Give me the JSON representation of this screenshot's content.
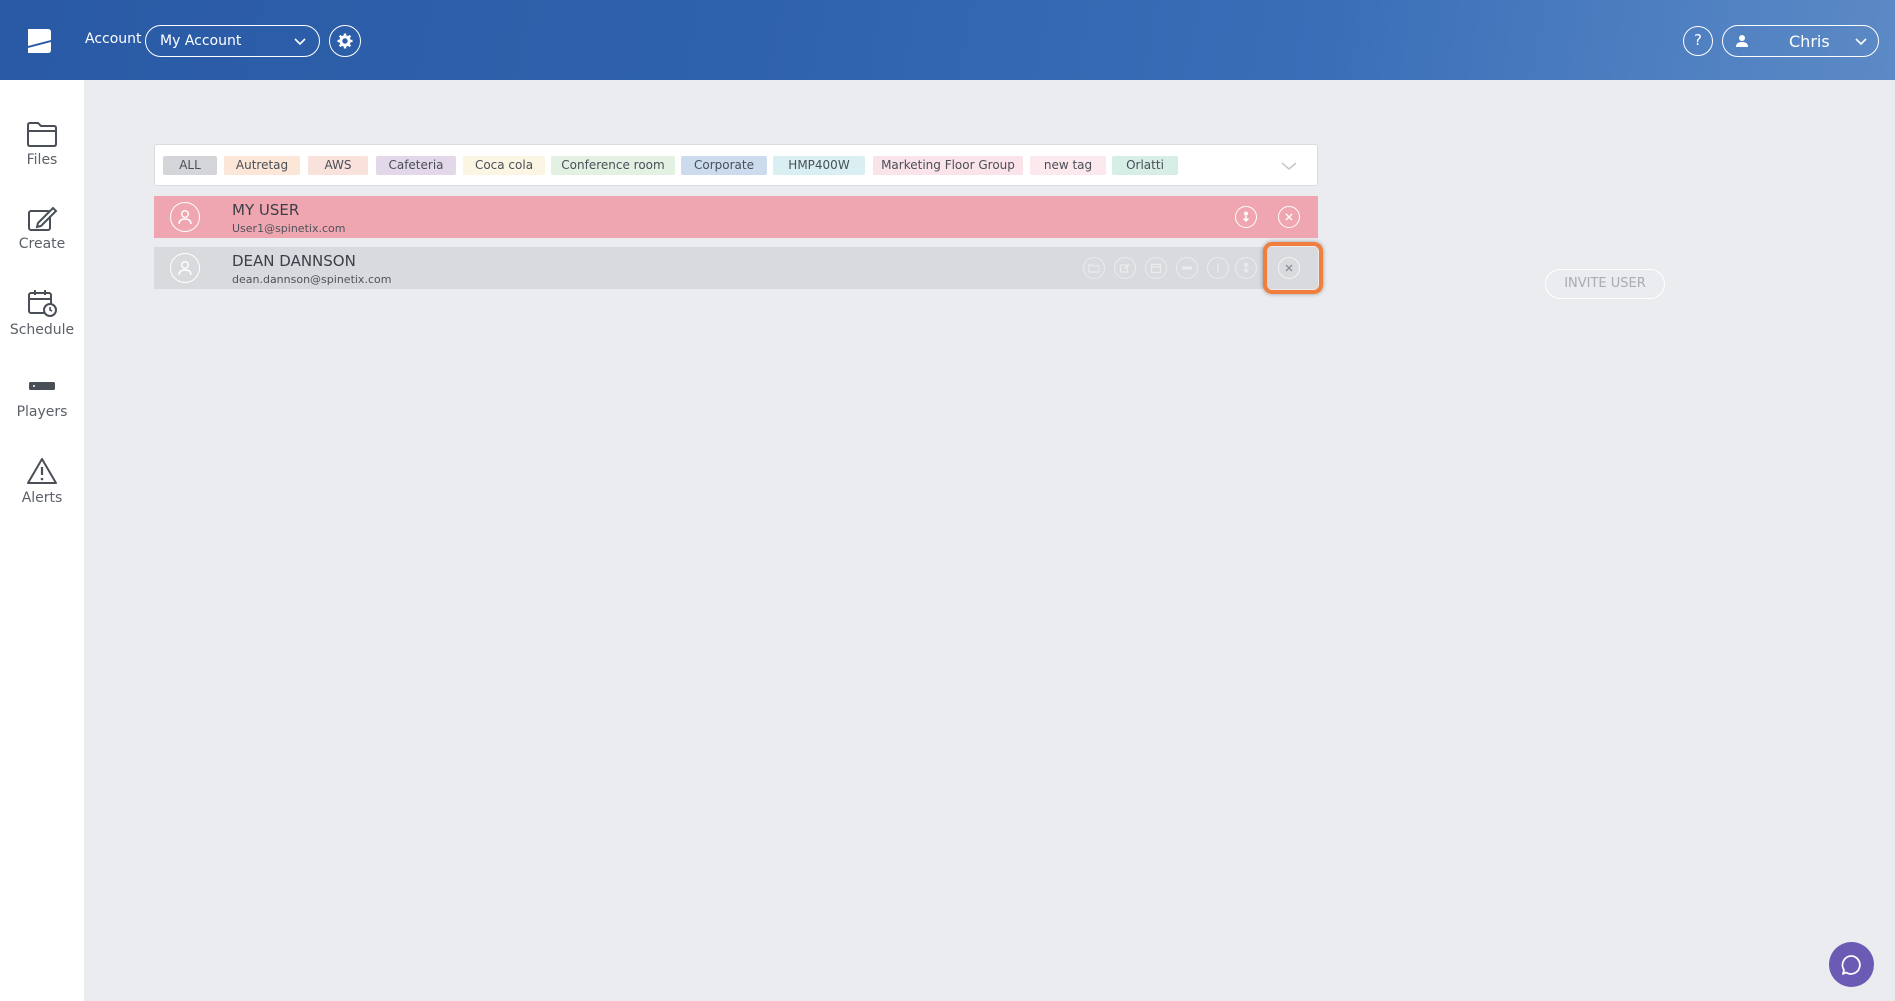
{
  "header": {
    "account_label": "Account",
    "account_select_value": "My Account",
    "help_label": "?",
    "user_name": "Chris"
  },
  "sidebar": {
    "items": [
      {
        "label": "Files",
        "icon": "folder-icon"
      },
      {
        "label": "Create",
        "icon": "create-icon"
      },
      {
        "label": "Schedule",
        "icon": "calendar-clock-icon"
      },
      {
        "label": "Players",
        "icon": "player-device-icon"
      },
      {
        "label": "Alerts",
        "icon": "warning-icon"
      }
    ]
  },
  "tags": [
    {
      "label": "ALL",
      "color": "#d3d5d9"
    },
    {
      "label": "Autretag",
      "color": "#fbe6d8"
    },
    {
      "label": "AWS",
      "color": "#f9e1dc"
    },
    {
      "label": "Cafeteria",
      "color": "#e3d7ea"
    },
    {
      "label": "Coca cola",
      "color": "#fbf6e3"
    },
    {
      "label": "Conference room",
      "color": "#e3f1e3"
    },
    {
      "label": "Corporate",
      "color": "#cddbef"
    },
    {
      "label": "HMP400W",
      "color": "#d9eff2"
    },
    {
      "label": "Marketing Floor Group",
      "color": "#fbe3ea"
    },
    {
      "label": "new tag",
      "color": "#fbe9ee"
    },
    {
      "label": "Orlatti",
      "color": "#d7eee6"
    }
  ],
  "users": [
    {
      "name": "MY USER",
      "email": "User1@spinetix.com"
    },
    {
      "name": "DEAN DANNSON",
      "email": "dean.dannson@spinetix.com"
    }
  ],
  "actions": {
    "invite_label": "INVITE USER"
  },
  "colors": {
    "header_blue": "#2f62ad",
    "me_row": "#efa6b0",
    "highlight": "#f07e3c",
    "chat": "#6c5bb4"
  }
}
